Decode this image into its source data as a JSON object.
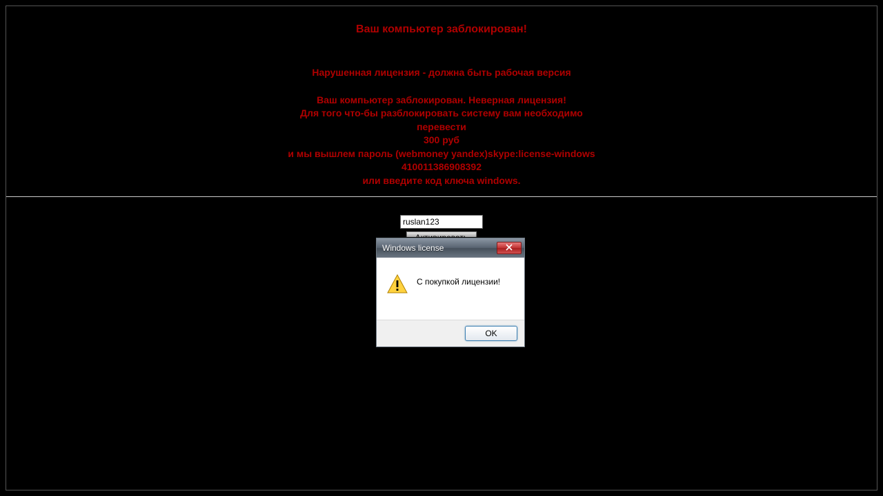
{
  "ransom": {
    "title": "Ваш компьютер заблокирован!",
    "line1": "Нарушенная лицензия - должна быть рабочая версия",
    "line2": "Ваш компьютер заблокирован. Неверная лицензия!",
    "line3": "Для того что-бы разблокировать систему вам необходимо",
    "line4": "перевести",
    "line5": "300 руб",
    "line6": "и мы вышлем пароль (webmoney yandex)skype:license-windows",
    "line7": "410011386908392",
    "line8": "или введите код ключа windows."
  },
  "form": {
    "code_value": "ruslan123",
    "activate_label": "Активировать"
  },
  "dialog": {
    "title": "Windows license",
    "message": "С покупкой лицензии!",
    "ok_label": "OK"
  }
}
